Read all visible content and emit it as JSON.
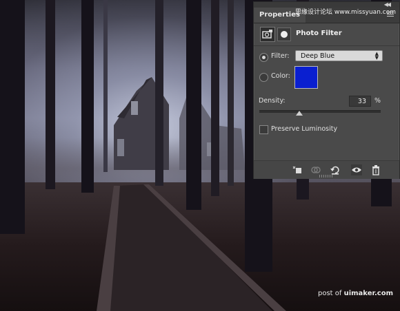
{
  "panel": {
    "tab_label": "Properties",
    "title": "Photo Filter",
    "filter": {
      "label": "Filter:",
      "selected": "Deep Blue",
      "selected_radio": true
    },
    "color": {
      "label": "Color:",
      "swatch": "#0a1fd0"
    },
    "density": {
      "label": "Density:",
      "value": "33",
      "unit": "%"
    },
    "preserve_luminosity": {
      "label": "Preserve Luminosity",
      "checked": false
    },
    "footer_icons": [
      "clip-to-layer-icon",
      "view-previous-state-icon",
      "reset-icon",
      "visibility-icon",
      "trash-icon"
    ]
  },
  "watermark_top": "思缘设计论坛 www.missyuan.com",
  "watermark_bottom": {
    "prefix": "post of",
    "brand": "uimaker.com"
  }
}
